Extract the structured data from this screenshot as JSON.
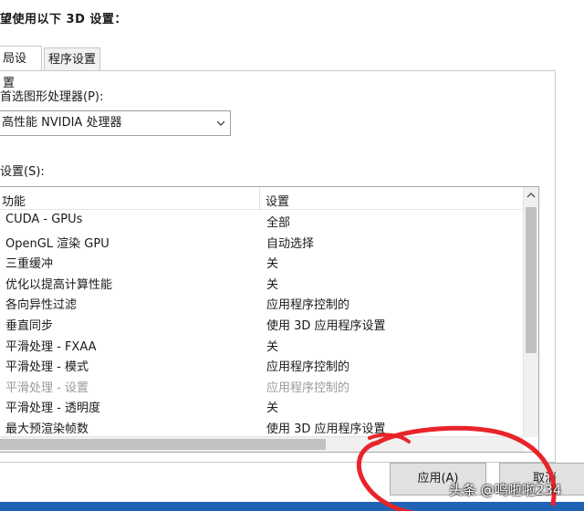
{
  "heading": "望使用以下 3D 设置：",
  "tabs": [
    {
      "label": "局设置",
      "active": true
    },
    {
      "label": "程序设置",
      "active": false
    }
  ],
  "gpu": {
    "label": "首选图形处理器(P):",
    "selected": "高性能 NVIDIA 处理器"
  },
  "settings": {
    "label": "设置(S):",
    "columns": [
      "功能",
      "设置"
    ],
    "rows": [
      {
        "feature": "CUDA - GPUs",
        "value": "全部",
        "disabled": false
      },
      {
        "feature": "OpenGL 渲染 GPU",
        "value": "自动选择",
        "disabled": false
      },
      {
        "feature": "三重缓冲",
        "value": "关",
        "disabled": false
      },
      {
        "feature": "优化以提高计算性能",
        "value": "关",
        "disabled": false
      },
      {
        "feature": "各向异性过滤",
        "value": "应用程序控制的",
        "disabled": false
      },
      {
        "feature": "垂直同步",
        "value": "使用 3D 应用程序设置",
        "disabled": false
      },
      {
        "feature": "平滑处理 - FXAA",
        "value": "关",
        "disabled": false
      },
      {
        "feature": "平滑处理 - 模式",
        "value": "应用程序控制的",
        "disabled": false
      },
      {
        "feature": "平滑处理 - 设置",
        "value": "应用程序控制的",
        "disabled": true
      },
      {
        "feature": "平滑处理 - 透明度",
        "value": "关",
        "disabled": false
      },
      {
        "feature": "最大预渲染帧数",
        "value": "使用 3D 应用程序设置",
        "disabled": false
      }
    ]
  },
  "buttons": {
    "apply": "应用(A)",
    "cancel": "取消"
  },
  "watermark": "头条 @鸣啦啦234",
  "colors": {
    "annotation_red": "#e8242a",
    "taskbar_blue": "#1e63b4"
  }
}
